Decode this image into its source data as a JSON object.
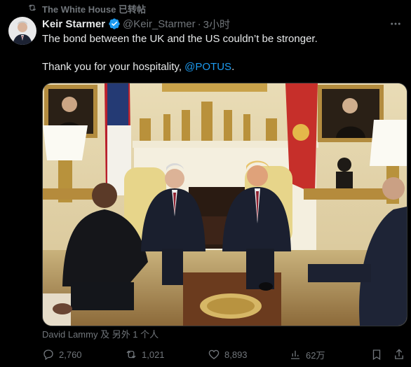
{
  "repost": {
    "text": "The White House 已转帖",
    "icon": "repost-icon"
  },
  "author": {
    "name": "Keir Starmer",
    "handle": "@Keir_Starmer",
    "separator": "·",
    "time": "3小时",
    "verified_icon": "verified-badge-icon",
    "verified_color": "#1d9bf0"
  },
  "tweet": {
    "line1": "The bond between the UK and the US couldn’t be stronger.",
    "line2_prefix": "Thank you for your hospitality, ",
    "mention": "@POTUS",
    "line2_suffix": "."
  },
  "media": {
    "tagged_text": "David Lammy 及 另外 1 个人",
    "tag_icon": "person-tag-icon"
  },
  "actions": {
    "reply_count": "2,760",
    "repost_count": "1,021",
    "like_count": "8,893",
    "views_count": "62万"
  },
  "colors": {
    "background": "#000000",
    "text": "#e7e9ea",
    "muted": "#71767b",
    "link": "#1d9bf0"
  }
}
